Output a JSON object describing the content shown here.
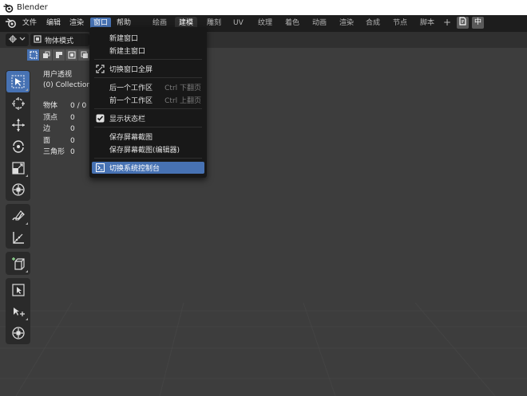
{
  "window": {
    "title": "Blender"
  },
  "menubar": {
    "items": [
      {
        "label": "文件"
      },
      {
        "label": "编辑"
      },
      {
        "label": "渲染"
      },
      {
        "label": "窗口"
      },
      {
        "label": "帮助"
      }
    ],
    "active": "窗口"
  },
  "workspaces": {
    "tabs": [
      {
        "label": "绘画"
      },
      {
        "label": "建模"
      },
      {
        "label": "雕刻"
      },
      {
        "label": "UV"
      },
      {
        "label": "纹理"
      },
      {
        "label": "着色"
      },
      {
        "label": "动画"
      },
      {
        "label": "渲染"
      },
      {
        "label": "合成"
      },
      {
        "label": "节点"
      },
      {
        "label": "脚本"
      }
    ],
    "active": "建模",
    "add_label": "+",
    "ime_label": "中"
  },
  "viewport_header": {
    "mode_label": "物体模式"
  },
  "overlay": {
    "view_name": "用户透视",
    "collection": "(0) Collection",
    "stats": [
      {
        "label": "物体",
        "value": "0 / 0"
      },
      {
        "label": "顶点",
        "value": "0"
      },
      {
        "label": "边",
        "value": "0"
      },
      {
        "label": "面",
        "value": "0"
      },
      {
        "label": "三角形",
        "value": "0"
      }
    ]
  },
  "window_menu": {
    "items": [
      {
        "label": "新建窗口",
        "shortcut": ""
      },
      {
        "label": "新建主窗口",
        "shortcut": ""
      },
      {
        "label": "切换窗口全屏",
        "shortcut": ""
      },
      {
        "label": "后一个工作区",
        "shortcut": "Ctrl 下翻页"
      },
      {
        "label": "前一个工作区",
        "shortcut": "Ctrl 上翻页"
      },
      {
        "label": "显示状态栏",
        "shortcut": ""
      },
      {
        "label": "保存屏幕截图",
        "shortcut": ""
      },
      {
        "label": "保存屏幕截图(编辑器)",
        "shortcut": ""
      },
      {
        "label": "切换系统控制台",
        "shortcut": ""
      }
    ],
    "status_bar_checked": true,
    "highlighted": "切换系统控制台"
  },
  "colors": {
    "accent": "#4772b3",
    "menu_bg": "#181818",
    "topbar_bg": "#1d1d1d",
    "viewport_bg": "#3d3d3d"
  }
}
